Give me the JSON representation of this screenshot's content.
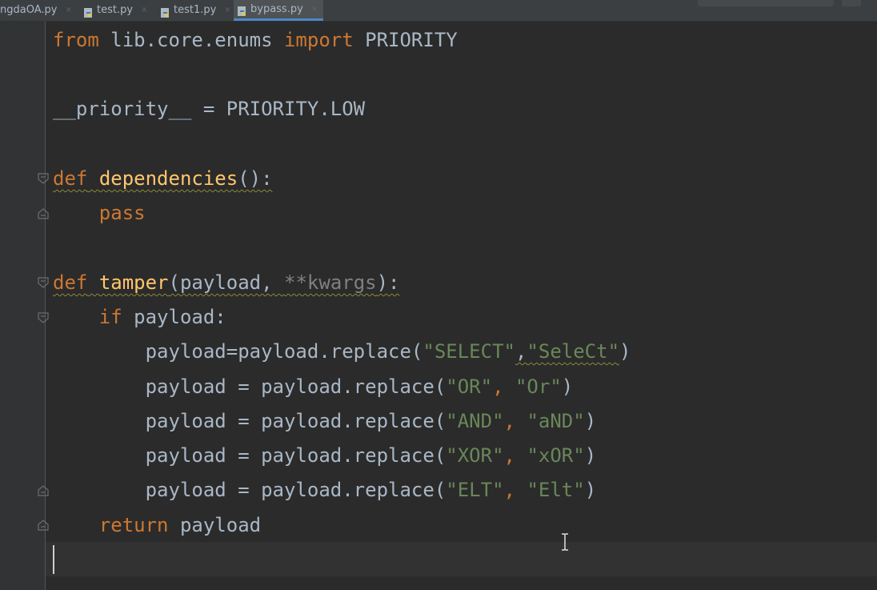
{
  "tabs": [
    {
      "label": "ngdaOA.py",
      "active": false
    },
    {
      "label": "test.py",
      "active": false
    },
    {
      "label": "test1.py",
      "active": false
    },
    {
      "label": "bypass.py",
      "active": true
    }
  ],
  "close_glyph": "×",
  "code": {
    "l1": {
      "kw1": "from",
      "t1": " lib.core.enums ",
      "kw2": "import",
      "t2": " PRIORITY"
    },
    "l2": {
      "text": "__priority__ = PRIORITY.LOW"
    },
    "l3": {
      "kw": "def",
      "fn": "dependencies",
      "rest": "():"
    },
    "l4": {
      "kw": "pass"
    },
    "l5": {
      "kw": "def",
      "fn": "tamper",
      "open": "(payload, ",
      "kwargs": "**kwargs",
      "close": "):"
    },
    "l6": {
      "kw": "if",
      "rest": " payload:"
    },
    "l7": {
      "a": "payload=payload.replace(",
      "s1": "\"SELECT\"",
      "comma": ",",
      "s2": "\"SeleCt\"",
      "b": ")"
    },
    "l8": {
      "a": "payload = payload.replace(",
      "s1": "\"OR\"",
      "comma": ", ",
      "s2": "\"Or\"",
      "b": ")"
    },
    "l9": {
      "a": "payload = payload.replace(",
      "s1": "\"AND\"",
      "comma": ", ",
      "s2": "\"aND\"",
      "b": ")"
    },
    "l10": {
      "a": "payload = payload.replace(",
      "s1": "\"XOR\"",
      "comma": ", ",
      "s2": "\"xOR\"",
      "b": ")"
    },
    "l11": {
      "a": "payload = payload.replace(",
      "s1": "\"ELT\"",
      "comma": ", ",
      "s2": "\"Elt\"",
      "b": ")"
    },
    "l12": {
      "kw": "return",
      "rest": " payload"
    }
  },
  "colors": {
    "keyword": "#cc7832",
    "function": "#ffc66d",
    "string": "#6a8759",
    "text": "#a9b7c6",
    "background": "#2b2b2b",
    "tab_active_underline": "#4a88c7"
  }
}
